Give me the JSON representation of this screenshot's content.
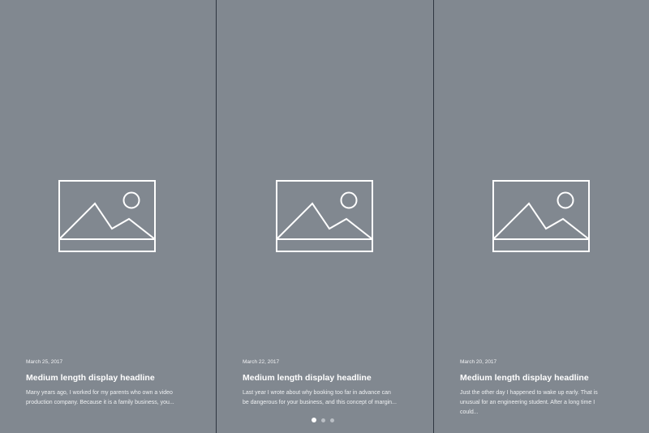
{
  "cards": [
    {
      "date": "March 25, 2017",
      "headline": "Medium length display headline",
      "excerpt": "Many years ago, I worked for my parents who own a video production company. Because it is a family business, you..."
    },
    {
      "date": "March 22, 2017",
      "headline": "Medium length display headline",
      "excerpt": "Last year I wrote about why booking too far in advance can be dangerous for your business, and this concept of margin..."
    },
    {
      "date": "March 20, 2017",
      "headline": "Medium length display headline",
      "excerpt": "Just the other day I happened to wake up early. That is unusual for an engineering student. After a long time I could..."
    }
  ],
  "pagination": {
    "count": 3,
    "active_index": 0
  },
  "icons": {
    "image_placeholder": "image-placeholder-icon"
  },
  "colors": {
    "card_background": "#818890",
    "divider": "#2f3640",
    "text": "#ffffff",
    "dot_inactive": "#b9bec4",
    "dot_active": "#ffffff"
  }
}
